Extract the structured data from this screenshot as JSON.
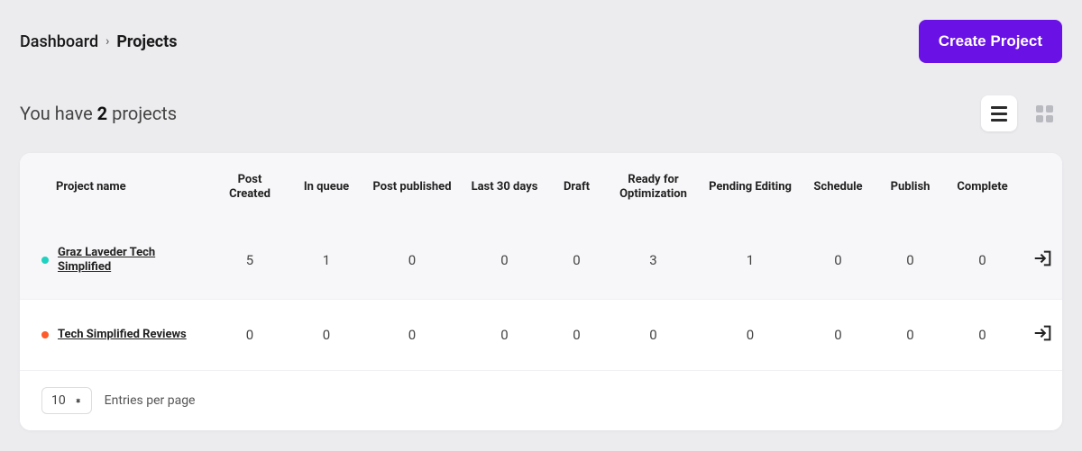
{
  "breadcrumb": {
    "root": "Dashboard",
    "current": "Projects"
  },
  "actions": {
    "create_project": "Create Project"
  },
  "summary": {
    "prefix": "You have ",
    "count": "2",
    "suffix": " projects"
  },
  "view": {
    "list_active": true
  },
  "columns": {
    "name": "Project name",
    "post_created": "Post Created",
    "in_queue": "In queue",
    "post_published": "Post published",
    "last_30": "Last 30 days",
    "draft": "Draft",
    "ready_opt": "Ready for Optimization",
    "pending_edit": "Pending Editing",
    "schedule": "Schedule",
    "publish": "Publish",
    "complete": "Complete"
  },
  "rows": [
    {
      "dot_color": "#1fd1c0",
      "name": "Graz Laveder Tech Simplified",
      "post_created": "5",
      "in_queue": "1",
      "post_published": "0",
      "last_30": "0",
      "draft": "0",
      "ready_opt": "3",
      "pending_edit": "1",
      "schedule": "0",
      "publish": "0",
      "complete": "0"
    },
    {
      "dot_color": "#ff5a2b",
      "name": "Tech Simplified Reviews",
      "post_created": "0",
      "in_queue": "0",
      "post_published": "0",
      "last_30": "0",
      "draft": "0",
      "ready_opt": "0",
      "pending_edit": "0",
      "schedule": "0",
      "publish": "0",
      "complete": "0"
    }
  ],
  "pagination": {
    "page_size": "10",
    "label": "Entries per page"
  }
}
